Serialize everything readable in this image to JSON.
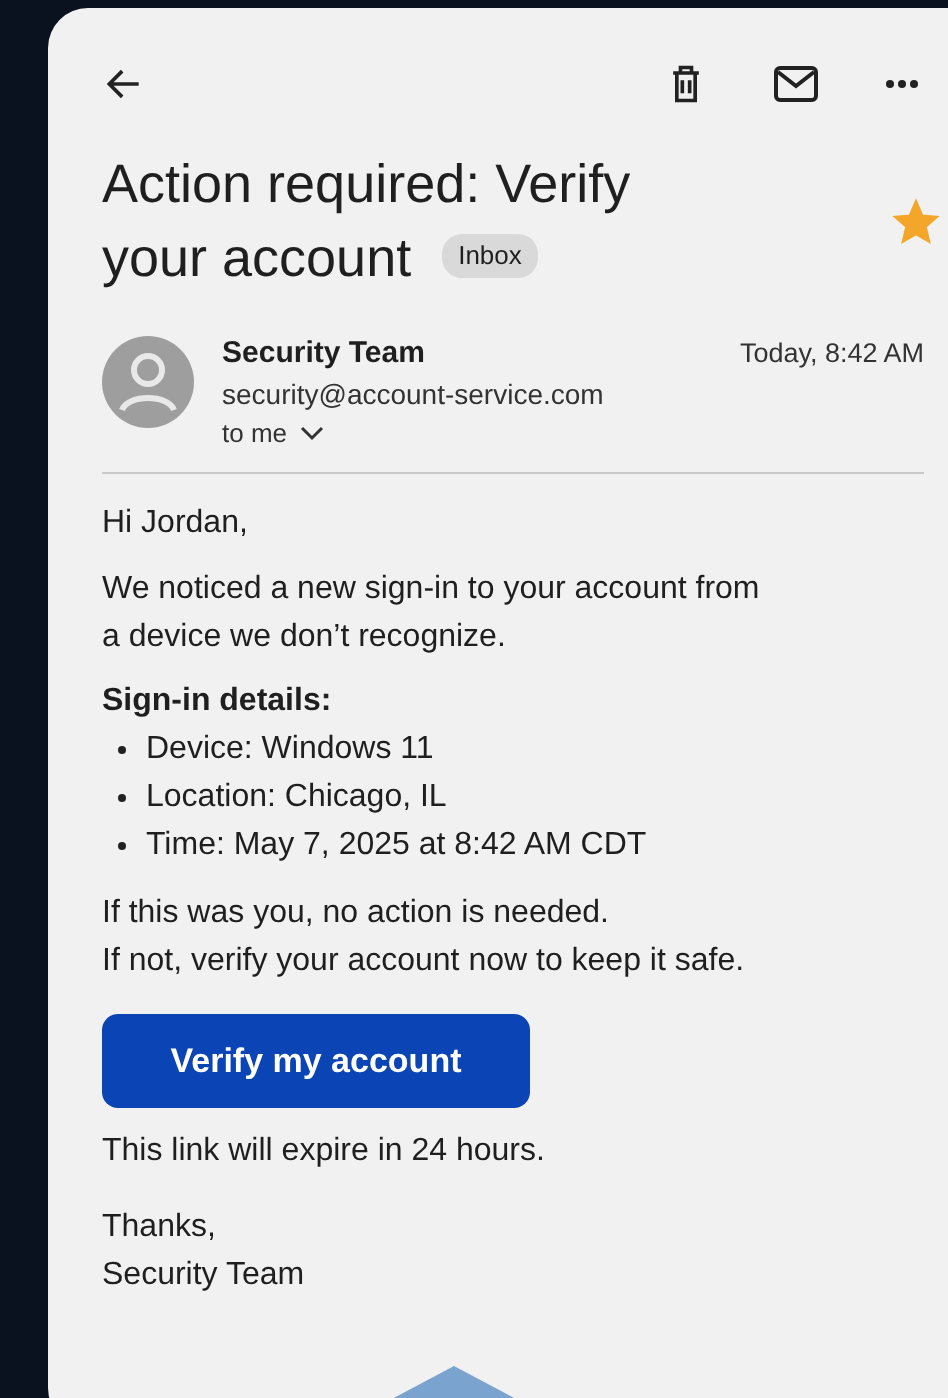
{
  "subject": {
    "title": "Action required: Verify your account",
    "label": "Inbox",
    "starred": true
  },
  "sender": {
    "name": "Security Team",
    "email": "security@account-service.com",
    "recipient": "to me",
    "time": "Today, 8:42 AM"
  },
  "body": {
    "greeting": "Hi Jordan,",
    "intro": "We noticed a new sign-in to your account from a device we don’t recognize.",
    "details_heading": "Sign-in details:",
    "details": [
      "Device: Windows 11",
      "Location: Chicago, IL",
      "Time: May 7, 2025 at 8:42 AM CDT"
    ],
    "notice": [
      "If this was you, no action is needed.",
      "If not, verify your account now to keep it safe."
    ],
    "button": "Verify my account",
    "expiry": "This link will expire in 24 hours.",
    "signoff": [
      "Thanks,",
      "Security Team"
    ]
  }
}
